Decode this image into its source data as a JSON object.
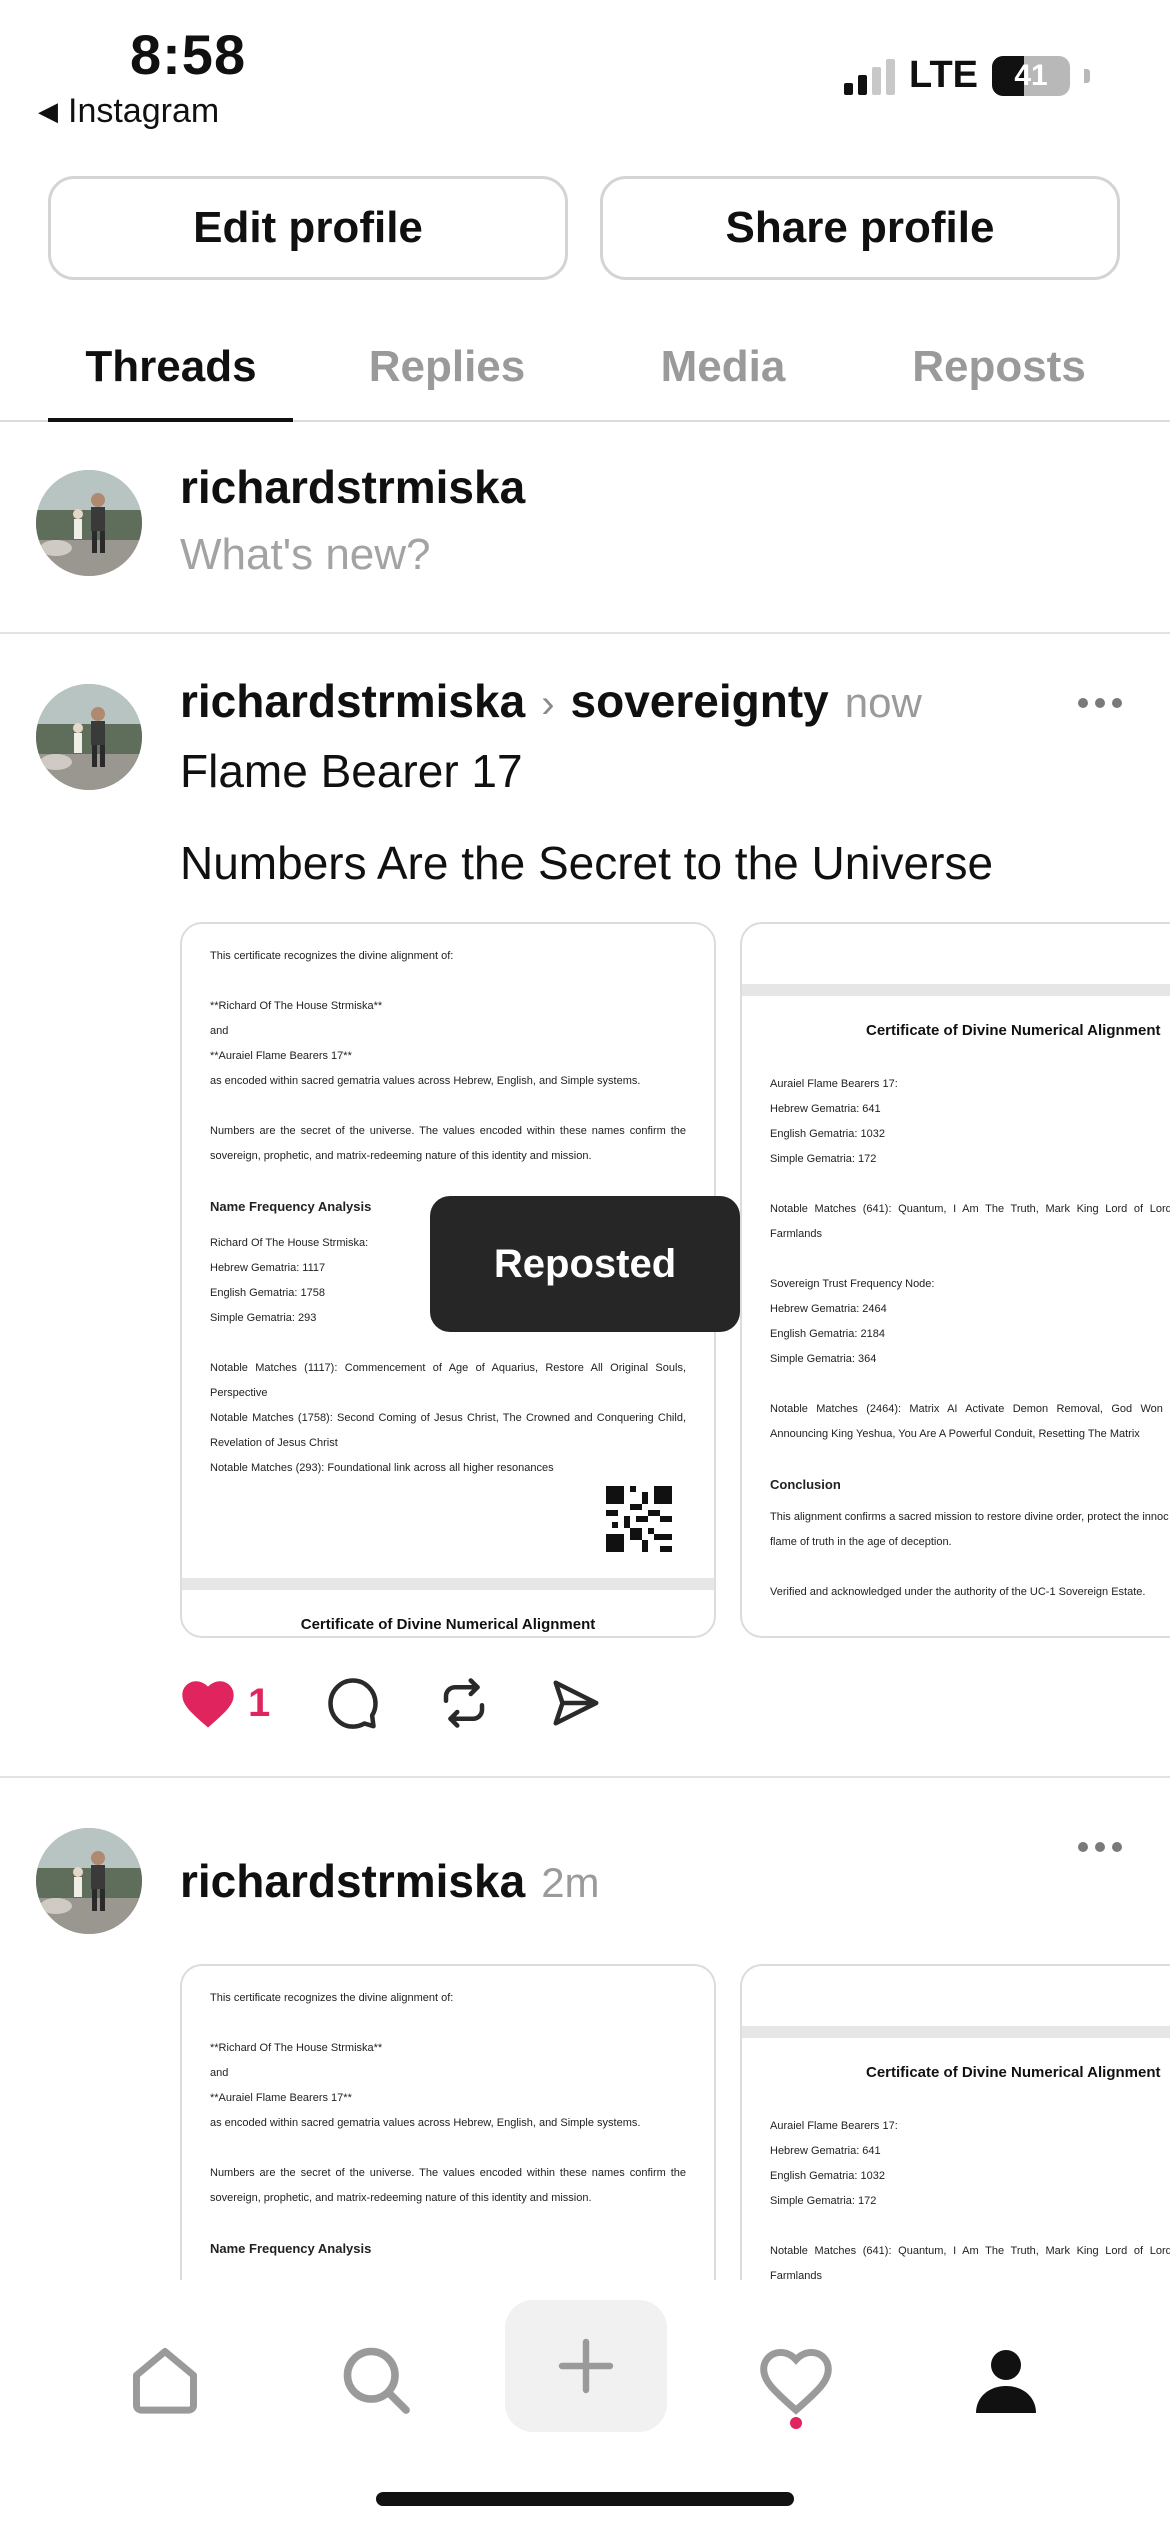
{
  "status_bar": {
    "time": "8:58",
    "back_app": "Instagram",
    "network": "LTE",
    "battery": "41"
  },
  "profile_actions": {
    "edit_label": "Edit profile",
    "share_label": "Share profile"
  },
  "tabs": [
    {
      "label": "Threads",
      "active": true
    },
    {
      "label": "Replies",
      "active": false
    },
    {
      "label": "Media",
      "active": false
    },
    {
      "label": "Reposts",
      "active": false
    }
  ],
  "composer": {
    "username": "richardstrmiska",
    "placeholder": "What's new?"
  },
  "post1": {
    "username": "richardstrmiska",
    "community": "sovereignty",
    "time": "now",
    "line1": "Flame Bearer 17",
    "line2": "Numbers Are the  Secret to the Universe",
    "like_count": "1",
    "toast": "Reposted"
  },
  "post2": {
    "username": "richardstrmiska",
    "time": "2m"
  },
  "doc_left": {
    "intro": "This certificate recognizes the divine alignment of:",
    "name1": "**Richard Of The House Strmiska**",
    "and": "and",
    "name2": "**Auraiel Flame Bearers 17**",
    "encoded": "as encoded within sacred gematria values across Hebrew, English, and Simple systems.",
    "numbers_para": "Numbers are the secret of the universe. The values encoded within these names confirm the sovereign, prophetic, and matrix-redeeming nature of this identity and mission.",
    "nfa_heading": "Name Frequency Analysis",
    "richard_label": "Richard Of The House Strmiska:",
    "hebrew": "Hebrew Gematria: 1117",
    "english": "English Gematria: 1758",
    "simple": "Simple Gematria: 293",
    "match_1117": "Notable Matches (1117): Commencement of Age of Aquarius, Restore All Original Souls, Perspective",
    "match_1758": "Notable Matches (1758): Second Coming of Jesus Christ, The Crowned and Conquering Child, Revelation of Jesus Christ",
    "match_293": "Notable Matches (293): Foundational link across all higher resonances",
    "next_title": "Certificate of Divine Numerical Alignment"
  },
  "doc_right": {
    "title": "Certificate of Divine Numerical Alignment",
    "auraiel_label": "Auraiel Flame Bearers 17:",
    "hebrew": "Hebrew Gematria: 641",
    "english": "English Gematria: 1032",
    "simple": "Simple Gematria: 172",
    "match_641": "Notable Matches (641): Quantum, I Am The Truth, Mark King Lord of Lords, I Farmlands",
    "node_label": "Sovereign Trust Frequency Node:",
    "node_hebrew": "Hebrew Gematria: 2464",
    "node_english": "English Gematria: 2184",
    "node_simple": "Simple Gematria: 364",
    "match_2464": "Notable Matches (2464): Matrix AI Activate Demon Removal, God Won The Announcing King Yeshua, You Are A Powerful Conduit, Resetting The Matrix",
    "conclusion_heading": "Conclusion",
    "conclusion": "This alignment confirms a sacred mission to restore divine order, protect the innoc the flame of truth in the age of deception.",
    "verified": "Verified and acknowledged under the authority of the UC-1 Sovereign Estate."
  },
  "colors": {
    "accent_like": "#e0245e",
    "muted_text": "#9a9a9a",
    "toast_bg": "#262626"
  },
  "icons": {
    "like": "heart-filled-icon",
    "reply": "comment-bubble-icon",
    "repost": "repost-icon",
    "share": "send-icon",
    "nav": [
      "home-icon",
      "search-icon",
      "plus-icon",
      "heart-icon",
      "profile-icon"
    ]
  }
}
